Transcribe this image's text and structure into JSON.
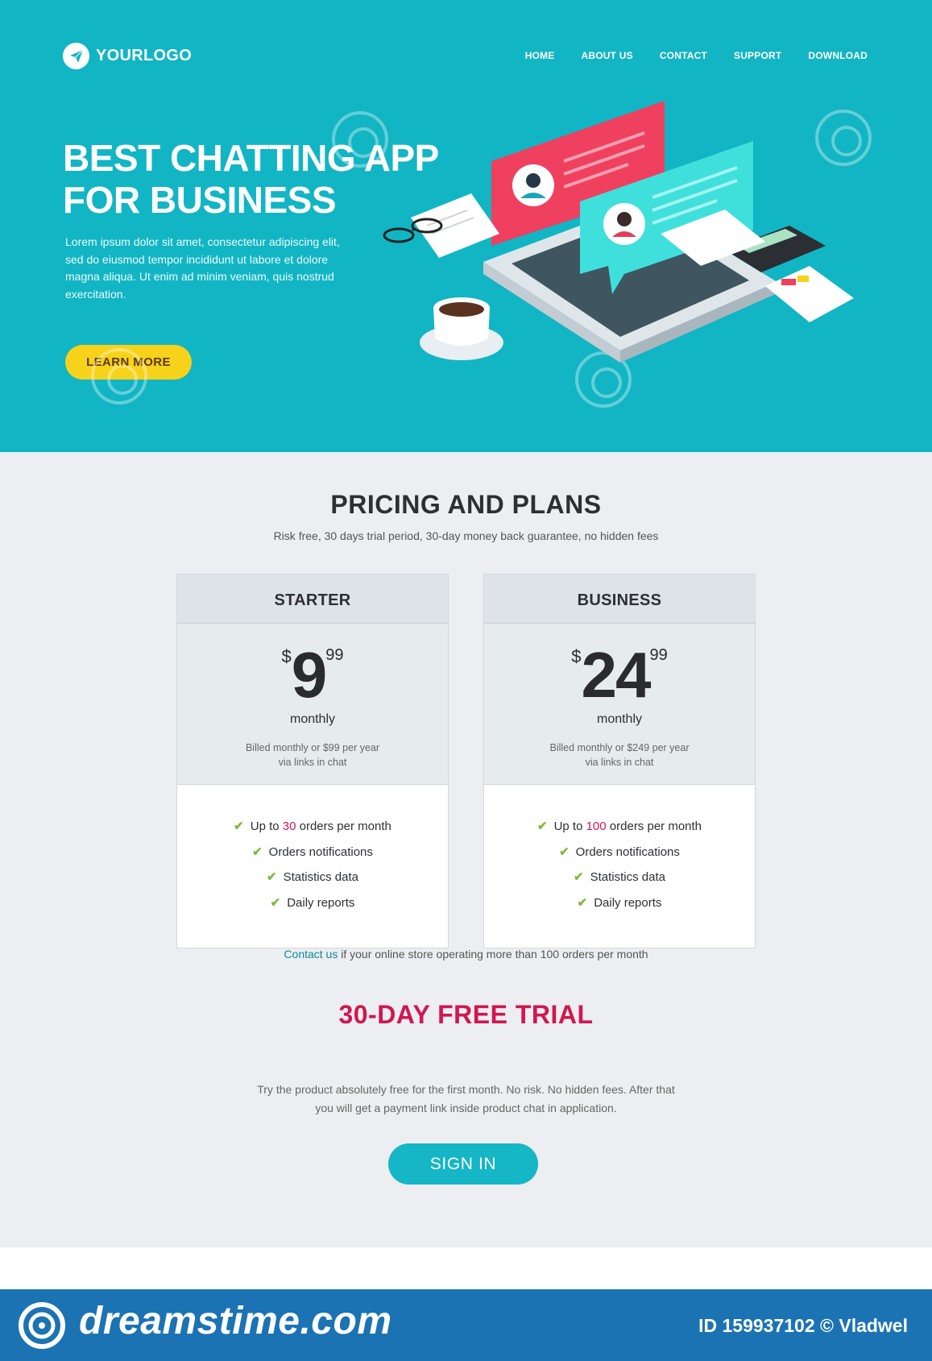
{
  "header": {
    "logo_text": "YOURLOGO",
    "nav": [
      "HOME",
      "ABOUT US",
      "CONTACT",
      "SUPPORT",
      "DOWNLOAD"
    ]
  },
  "hero": {
    "title_line1": "BEST CHATTING APP",
    "title_line2": "FOR BUSINESS",
    "text": "Lorem ipsum dolor sit amet, consectetur adipiscing elit, sed do eiusmod tempor incididunt ut labore et dolore magna aliqua. Ut enim ad minim veniam, quis nostrud exercitation.",
    "button": "LEARN MORE"
  },
  "pricing": {
    "title": "PRICING AND PLANS",
    "subtitle": "Risk free, 30 days trial period, 30-day money back guarantee, no hidden fees",
    "plans": [
      {
        "name": "STARTER",
        "currency": "$",
        "price": "9",
        "cents": "99",
        "period": "monthly",
        "billed_line1": "Billed monthly or $99 per year",
        "billed_line2": "via links in chat",
        "feature_prefix": "Up to ",
        "feature_value": "30",
        "feature_suffix": " orders per month",
        "features": [
          "Orders notifications",
          "Statistics data",
          "Daily reports"
        ]
      },
      {
        "name": "BUSINESS",
        "currency": "$",
        "price": "24",
        "cents": "99",
        "period": "monthly",
        "billed_line1": "Billed monthly or $249 per year",
        "billed_line2": "via links in chat",
        "feature_prefix": "Up to ",
        "feature_value": "100",
        "feature_suffix": " orders per month",
        "features": [
          "Orders notifications",
          "Statistics data",
          "Daily reports"
        ]
      }
    ],
    "contact_link": "Contact us",
    "contact_rest": " if your online store operating more than 100 orders per month"
  },
  "trial": {
    "title": "30-DAY FREE TRIAL",
    "text_line1": "Try the product absolutely free for the first month. No risk. No hidden fees. After that",
    "text_line2": "you will get a payment link inside product chat in application.",
    "button": "SIGN IN"
  },
  "footer": {
    "brand": "dreamstime.com",
    "id_text": "ID 159937102 © Vladwel"
  },
  "colors": {
    "hero_bg": "#12b5c4",
    "accent_yellow": "#f7d21a",
    "accent_red": "#d0174f",
    "footer_bg": "#1b73b3"
  }
}
